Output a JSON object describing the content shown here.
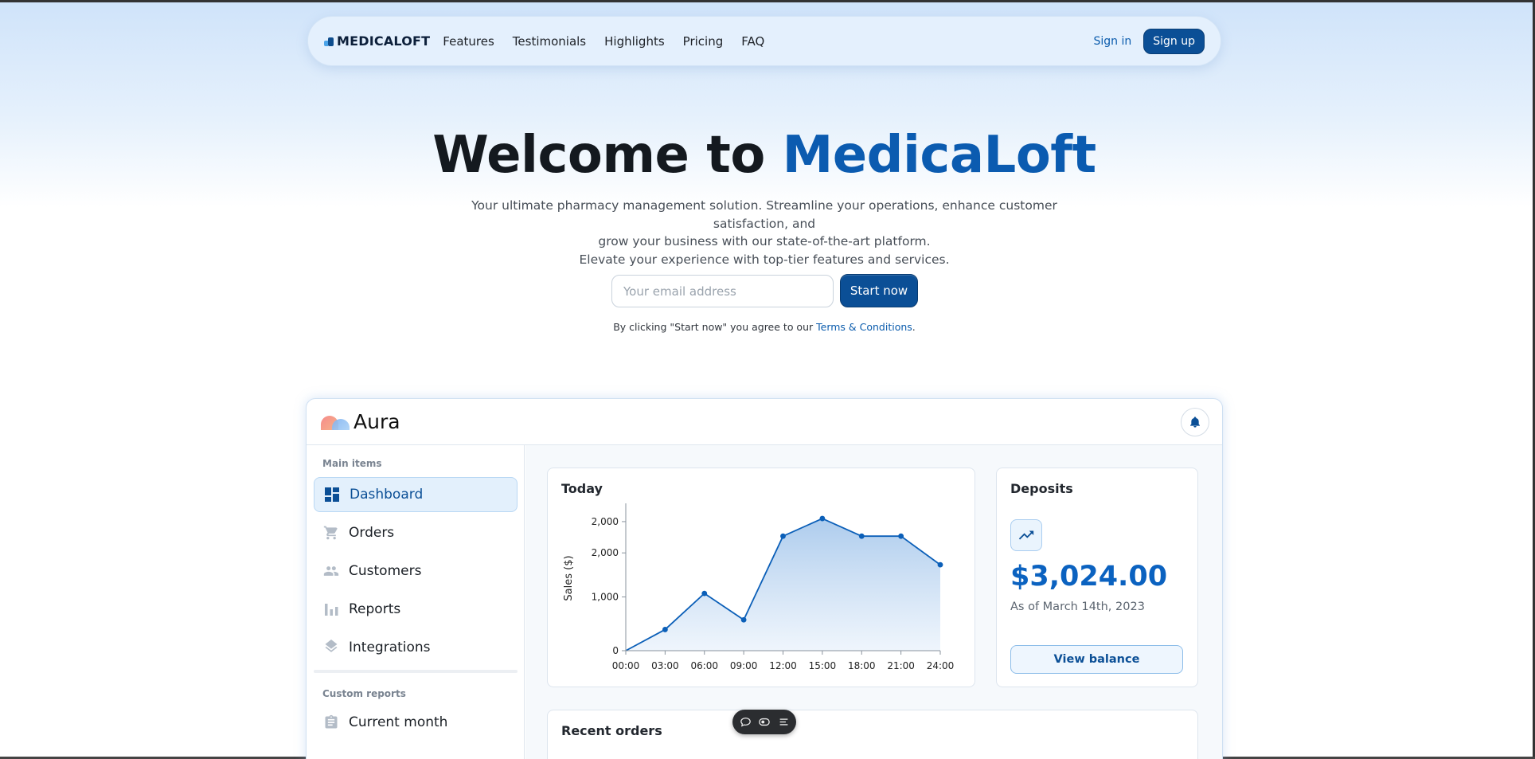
{
  "navbar": {
    "brand": "MEDICALOFT",
    "links": [
      "Features",
      "Testimonials",
      "Highlights",
      "Pricing",
      "FAQ"
    ],
    "sign_in": "Sign in",
    "sign_up": "Sign up"
  },
  "hero": {
    "title_prefix": "Welcome to ",
    "title_brand": "MedicaLoft",
    "subtitle_line1": "Your ultimate pharmacy management solution. Streamline your operations, enhance customer satisfaction, and",
    "subtitle_line2": "grow your business with our state-of-the-art platform.",
    "subtitle_line3": "Elevate your experience with top-tier features and services.",
    "email_placeholder": "Your email address",
    "cta": "Start now",
    "terms_prefix": "By clicking \"Start now\" you agree to our ",
    "terms_link": "Terms & Conditions",
    "terms_suffix": "."
  },
  "dashboard": {
    "app_name": "Aura",
    "sidebar": {
      "section_main": "Main items",
      "items": [
        {
          "label": "Dashboard",
          "icon": "dashboard-icon"
        },
        {
          "label": "Orders",
          "icon": "cart-icon"
        },
        {
          "label": "Customers",
          "icon": "people-icon"
        },
        {
          "label": "Reports",
          "icon": "bar-chart-icon"
        },
        {
          "label": "Integrations",
          "icon": "layers-icon"
        }
      ],
      "section_custom": "Custom reports",
      "custom_items": [
        {
          "label": "Current month",
          "icon": "clipboard-icon"
        }
      ]
    },
    "today_card": {
      "title": "Today"
    },
    "deposits_card": {
      "title": "Deposits",
      "amount": "$3,024.00",
      "date": "As of March 14th, 2023",
      "button": "View balance"
    },
    "recent_orders": {
      "title": "Recent orders"
    }
  },
  "colors": {
    "primary": "#0b4f96",
    "accent": "#0b5bb0",
    "line": "#0b5fb8"
  },
  "chart_data": {
    "type": "area",
    "title": "Today",
    "ylabel": "Sales ($)",
    "xlabel": "",
    "x": [
      "00:00",
      "03:00",
      "06:00",
      "09:00",
      "12:00",
      "15:00",
      "18:00",
      "21:00",
      "24:00"
    ],
    "y_ticks": [
      "0",
      "1,000",
      "2,000",
      "2,000"
    ],
    "ylim": [
      0,
      3200
    ],
    "series": [
      {
        "values": [
          0,
          480,
          1300,
          700,
          2600,
          3000,
          2600,
          2600,
          1950
        ]
      }
    ],
    "grid": false
  }
}
